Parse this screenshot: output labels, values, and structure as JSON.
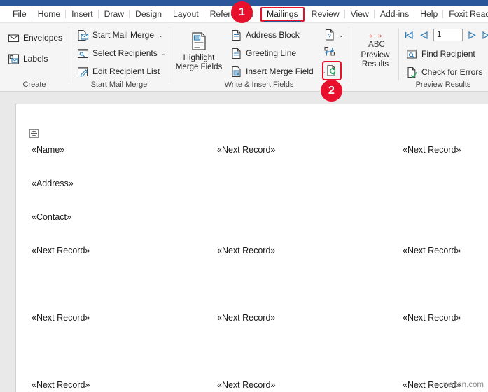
{
  "window": {
    "titlebar_color": "#2b579a",
    "accent_red": "#e8112d"
  },
  "tabs": [
    {
      "label": "File",
      "active": false
    },
    {
      "label": "Home",
      "active": false
    },
    {
      "label": "Insert",
      "active": false
    },
    {
      "label": "Draw",
      "active": false
    },
    {
      "label": "Design",
      "active": false
    },
    {
      "label": "Layout",
      "active": false
    },
    {
      "label": "References",
      "active": false
    },
    {
      "label": "Mailings",
      "active": true
    },
    {
      "label": "Review",
      "active": false
    },
    {
      "label": "View",
      "active": false
    },
    {
      "label": "Add-ins",
      "active": false
    },
    {
      "label": "Help",
      "active": false
    },
    {
      "label": "Foxit Reader",
      "active": false
    }
  ],
  "ribbon": {
    "groups": [
      {
        "name": "Create",
        "label": "Create",
        "items": [
          {
            "label": "Envelopes",
            "icon": "envelope-icon"
          },
          {
            "label": "Labels",
            "icon": "labels-icon"
          }
        ]
      },
      {
        "name": "Start Mail Merge",
        "label": "Start Mail Merge",
        "items": [
          {
            "label": "Start Mail Merge",
            "icon": "start-mail-merge-icon",
            "caret": "⌄"
          },
          {
            "label": "Select Recipients",
            "icon": "select-recipients-icon",
            "caret": "⌄"
          },
          {
            "label": "Edit Recipient List",
            "icon": "edit-recipient-list-icon",
            "caret": ""
          }
        ]
      },
      {
        "name": "Write & Insert Fields",
        "label": "Write & Insert Fields",
        "big_button": {
          "label_line1": "Highlight",
          "label_line2": "Merge Fields",
          "icon": "highlight-merge-fields-icon"
        },
        "items": [
          {
            "label": "Address Block",
            "icon": "address-block-icon",
            "caret": ""
          },
          {
            "label": "Greeting Line",
            "icon": "greeting-line-icon",
            "caret": ""
          },
          {
            "label": "Insert Merge Field",
            "icon": "insert-merge-field-icon",
            "caret": "⌄"
          }
        ],
        "icon_buttons": [
          {
            "name": "rules-button",
            "icon": "rules-icon",
            "caret": "⌄",
            "highlighted": false
          },
          {
            "name": "match-fields-button",
            "icon": "match-fields-icon",
            "caret": "",
            "highlighted": false
          },
          {
            "name": "update-labels-button",
            "icon": "update-labels-icon",
            "caret": "",
            "highlighted": true
          }
        ]
      },
      {
        "name": "Preview Results",
        "label": "Preview Results",
        "big_button": {
          "label_line1": "Preview",
          "label_line2": "Results",
          "icon": "preview-results-abc-icon",
          "glyph": "ABC"
        },
        "record_number": "1",
        "nav": [
          {
            "name": "first-record-button",
            "icon": "first-record-icon"
          },
          {
            "name": "previous-record-button",
            "icon": "previous-record-icon"
          },
          {
            "name": "next-record-button",
            "icon": "next-record-icon"
          },
          {
            "name": "last-record-button",
            "icon": "last-record-icon"
          }
        ],
        "items": [
          {
            "label": "Find Recipient",
            "icon": "find-recipient-icon"
          },
          {
            "label": "Check for Errors",
            "icon": "check-for-errors-icon"
          }
        ]
      }
    ]
  },
  "annotations": [
    {
      "number": "1",
      "target": "mailings-tab"
    },
    {
      "number": "2",
      "target": "update-labels-button"
    }
  ],
  "document": {
    "merge_fields": [
      {
        "text": "«Name»",
        "col": 0,
        "row": 0
      },
      {
        "text": "«Next Record»",
        "col": 1,
        "row": 0
      },
      {
        "text": "«Next Record»",
        "col": 2,
        "row": 0
      },
      {
        "text": "«Address»",
        "col": 0,
        "row": 1
      },
      {
        "text": "«Contact»",
        "col": 0,
        "row": 2
      },
      {
        "text": "«Next Record»",
        "col": 0,
        "row": 3
      },
      {
        "text": "«Next Record»",
        "col": 1,
        "row": 3
      },
      {
        "text": "«Next Record»",
        "col": 2,
        "row": 3
      },
      {
        "text": "«Next Record»",
        "col": 0,
        "row": 4
      },
      {
        "text": "«Next Record»",
        "col": 1,
        "row": 4
      },
      {
        "text": "«Next Record»",
        "col": 2,
        "row": 4
      },
      {
        "text": "«Next Record»",
        "col": 0,
        "row": 5
      },
      {
        "text": "«Next Record»",
        "col": 1,
        "row": 5
      },
      {
        "text": "«Next Record»",
        "col": 2,
        "row": 5
      }
    ],
    "watermark": "wsxdn.com"
  }
}
